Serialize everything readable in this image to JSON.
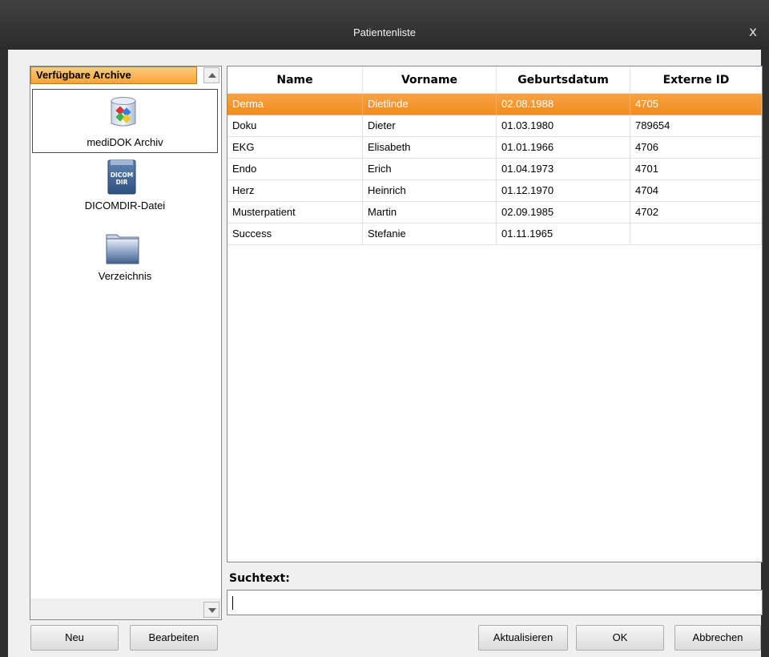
{
  "window": {
    "title": "Patientenliste",
    "close_glyph": "x"
  },
  "archives": {
    "header": "Verfügbare Archive",
    "items": [
      {
        "label": "mediDOK Archiv",
        "icon": "database-icon",
        "selected": true
      },
      {
        "label": "DICOMDIR-Datei",
        "icon": "dicomdir-icon",
        "icon_text_top": "DICOM",
        "icon_text_bottom": "DIR"
      },
      {
        "label": "Verzeichnis",
        "icon": "folder-icon"
      }
    ]
  },
  "table": {
    "columns": [
      "Name",
      "Vorname",
      "Geburtsdatum",
      "Externe ID"
    ],
    "rows": [
      {
        "name": "Derma",
        "vorname": "Dietlinde",
        "geburtsdatum": "02.08.1988",
        "externe_id": "4705",
        "selected": true
      },
      {
        "name": "Doku",
        "vorname": "Dieter",
        "geburtsdatum": "01.03.1980",
        "externe_id": "789654"
      },
      {
        "name": "EKG",
        "vorname": "Elisabeth",
        "geburtsdatum": "01.01.1966",
        "externe_id": "4706"
      },
      {
        "name": "Endo",
        "vorname": "Erich",
        "geburtsdatum": "01.04.1973",
        "externe_id": "4701"
      },
      {
        "name": "Herz",
        "vorname": "Heinrich",
        "geburtsdatum": "01.12.1970",
        "externe_id": "4704"
      },
      {
        "name": "Musterpatient",
        "vorname": "Martin",
        "geburtsdatum": "02.09.1985",
        "externe_id": "4702"
      },
      {
        "name": "Success",
        "vorname": "Stefanie",
        "geburtsdatum": "01.11.1965",
        "externe_id": ""
      }
    ]
  },
  "search": {
    "label": "Suchtext:",
    "value": ""
  },
  "buttons": {
    "neu": "Neu",
    "bearbeiten": "Bearbeiten",
    "aktualisieren": "Aktualisieren",
    "ok": "OK",
    "abbrechen": "Abbrechen"
  },
  "colors": {
    "selection": "#f39a33",
    "titlebar": "#363636"
  }
}
